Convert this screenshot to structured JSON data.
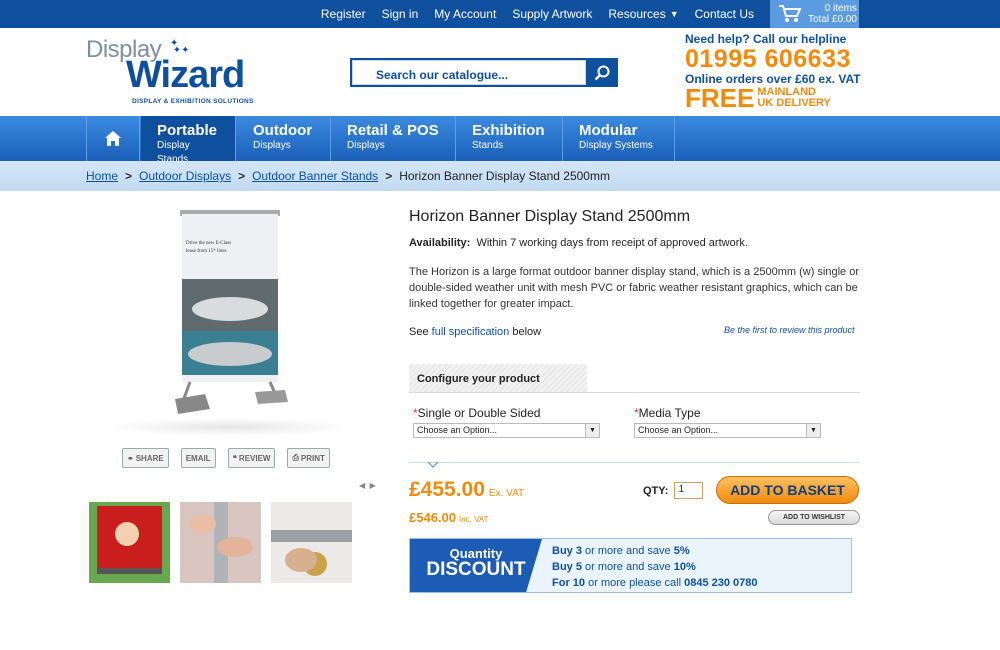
{
  "topnav": {
    "links": [
      "Register",
      "Sign in",
      "My Account",
      "Supply Artwork",
      "Resources",
      "Contact Us"
    ],
    "resources_arrow": "▼",
    "cart_items": "0 items",
    "cart_total": "Total £0.00"
  },
  "logo": {
    "line1": "Display",
    "line2": "Wizard",
    "tagline": "DISPLAY & EXHIBITION SOLUTIONS",
    "tm": "™"
  },
  "search": {
    "placeholder": "Search our catalogue..."
  },
  "helpline": {
    "heading": "Need help? Call our helpline",
    "phone": "01995 606633",
    "orders": "Online orders over £60 ex. VAT",
    "free": "FREE",
    "delivery_line1": "MAINLAND",
    "delivery_line2": "UK DELIVERY"
  },
  "mainnav": [
    {
      "title": "Portable",
      "sub": "Display Stands"
    },
    {
      "title": "Outdoor",
      "sub": "Displays"
    },
    {
      "title": "Retail & POS",
      "sub": "Displays"
    },
    {
      "title": "Exhibition",
      "sub": "Stands"
    },
    {
      "title": "Modular",
      "sub": "Display Systems"
    }
  ],
  "breadcrumb": {
    "home": "Home",
    "c1": "Outdoor Displays",
    "c2": "Outdoor Banner Stands",
    "current": "Horizon Banner Display Stand 2500mm",
    "sep": ">"
  },
  "banner_text": {
    "l1": "Drive the new E-Class",
    "l2": "lease from 15* lines"
  },
  "share": {
    "share": "SHARE",
    "email": "EMAIL",
    "review": "REVIEW",
    "print": "PRINT"
  },
  "product": {
    "title": "Horizon Banner Display Stand 2500mm",
    "availability_label": "Availability:",
    "availability": "Within 7 working days from receipt of approved artwork.",
    "description": "The Horizon is a large format outdoor banner display stand, which is a 2500mm (w) single or double-sided weather unit with mesh PVC or fabric weather resistant graphics, which can be linked together for greater impact.",
    "see_prefix": "See",
    "see_link": "full specification",
    "see_suffix": "below",
    "review_link": "Be the first to review this product"
  },
  "configure": {
    "heading": "Configure your product",
    "options": [
      {
        "label": "Single or Double Sided",
        "value": "Choose an Option..."
      },
      {
        "label": "Media Type",
        "value": "Choose an Option..."
      }
    ],
    "required_mark": "*"
  },
  "pricing": {
    "price_ex": "£455.00",
    "ex_label": "Ex. VAT",
    "price_inc": "£546.00",
    "inc_label": "Inc. VAT",
    "qty_label": "QTY:",
    "qty_value": "1",
    "add_to_basket": "ADD TO BASKET",
    "add_to_wishlist": "ADD TO WISHLIST"
  },
  "discount": {
    "badge_top": "Quantity",
    "badge_bottom": "DISCOUNT",
    "lines": [
      {
        "a": "Buy",
        "n": "3",
        "b": "or more and save",
        "v": "5%"
      },
      {
        "a": "Buy",
        "n": "5",
        "b": "or more and save",
        "v": "10%"
      },
      {
        "a": "For",
        "n": "10",
        "b": "or more please call",
        "v": "0845 230 0780"
      }
    ]
  },
  "colors": {
    "brand_blue": "#0e4f9e",
    "orange": "#f28b0c"
  }
}
